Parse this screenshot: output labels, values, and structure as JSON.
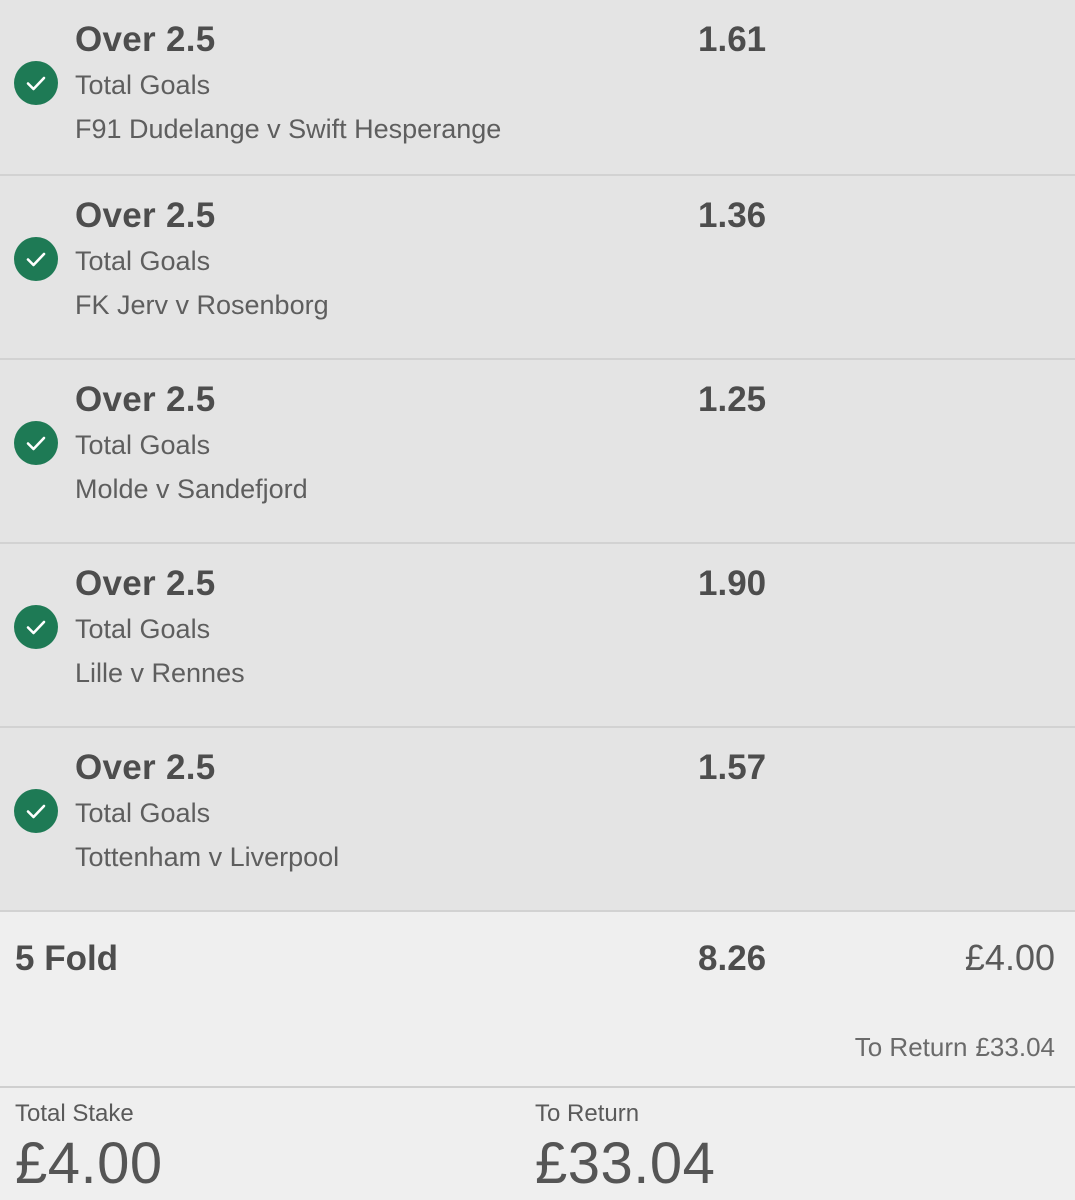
{
  "selections": [
    {
      "name": "Over 2.5",
      "market": "Total Goals",
      "event": "F91 Dudelange v Swift Hesperange",
      "odds": "1.61"
    },
    {
      "name": "Over 2.5",
      "market": "Total Goals",
      "event": "FK Jerv v Rosenborg",
      "odds": "1.36"
    },
    {
      "name": "Over 2.5",
      "market": "Total Goals",
      "event": "Molde v Sandefjord",
      "odds": "1.25"
    },
    {
      "name": "Over 2.5",
      "market": "Total Goals",
      "event": "Lille v Rennes",
      "odds": "1.90"
    },
    {
      "name": "Over 2.5",
      "market": "Total Goals",
      "event": "Tottenham v Liverpool",
      "odds": "1.57"
    }
  ],
  "fold": {
    "title": "5 Fold",
    "odds": "8.26",
    "stake": "£4.00",
    "return_label": "To Return",
    "return_value": "£33.04"
  },
  "totals": {
    "stake_label": "Total Stake",
    "stake_value": "£4.00",
    "return_label": "To Return",
    "return_value": "£33.04"
  },
  "icons": {
    "check": "check-circle-icon"
  },
  "colors": {
    "accent_green": "#1e7a55",
    "selection_bg": "#e4e4e4",
    "footer_bg": "#efefef"
  }
}
